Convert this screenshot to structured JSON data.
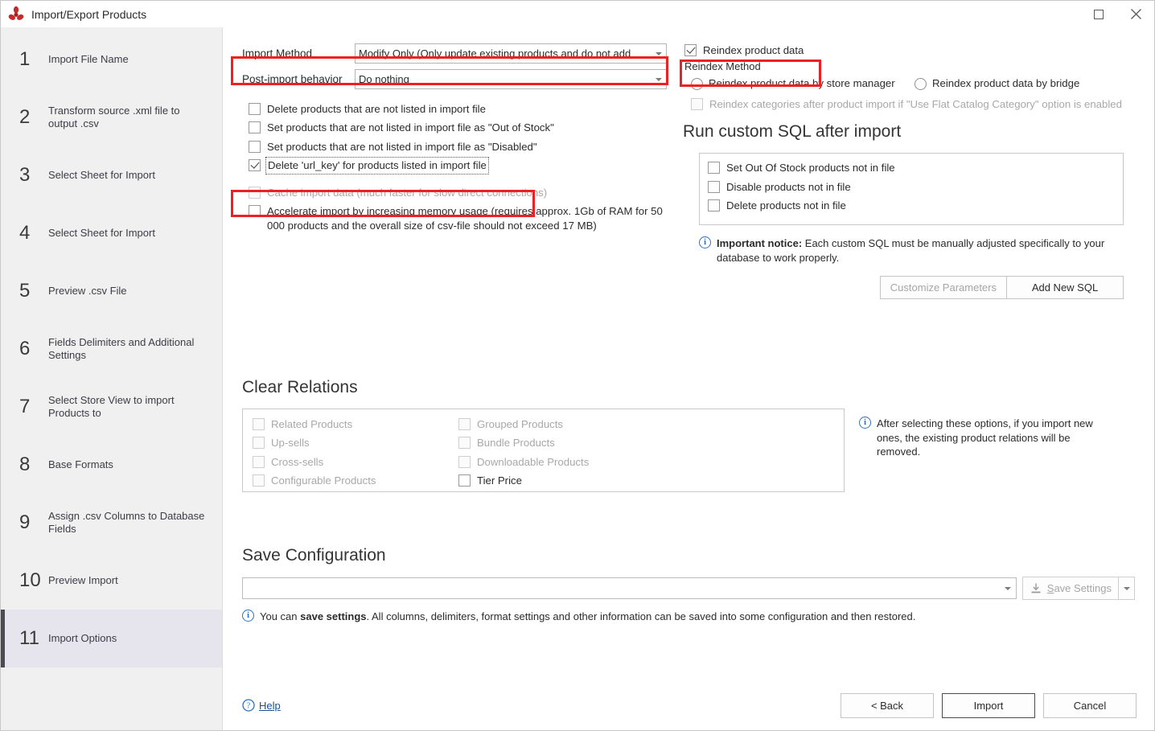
{
  "window": {
    "title": "Import/Export Products",
    "app_icon": "store-manager-logo-icon",
    "maximize_label": "",
    "close_label": "✕"
  },
  "sidebar": {
    "steps": [
      {
        "num": "1",
        "label": "Import File Name",
        "selected": false
      },
      {
        "num": "2",
        "label": "Transform source .xml file to output .csv",
        "selected": false
      },
      {
        "num": "3",
        "label": "Select Sheet for Import",
        "selected": false
      },
      {
        "num": "4",
        "label": "Select Sheet for Import",
        "selected": false
      },
      {
        "num": "5",
        "label": "Preview .csv File",
        "selected": false
      },
      {
        "num": "6",
        "label": "Fields Delimiters and Additional Settings",
        "selected": false
      },
      {
        "num": "7",
        "label": "Select Store View to import Products to",
        "selected": false
      },
      {
        "num": "8",
        "label": "Base Formats",
        "selected": false
      },
      {
        "num": "9",
        "label": "Assign .csv Columns to Database Fields",
        "selected": false
      },
      {
        "num": "10",
        "label": "Preview Import",
        "selected": false
      },
      {
        "num": "11",
        "label": "Import Options",
        "selected": true
      }
    ]
  },
  "import_method": {
    "label": "Import Method",
    "value": "Modify Only (Only update existing products and do not add",
    "highlighted": true
  },
  "post_import": {
    "label": "Post-import behavior",
    "value": "Do nothing"
  },
  "options": [
    {
      "label": "Delete products that are not listed in import file",
      "checked": false,
      "disabled": false,
      "focused": false
    },
    {
      "label": "Set products that are not listed in import file as \"Out of Stock\"",
      "checked": false,
      "disabled": false,
      "focused": false
    },
    {
      "label": "Set products that are not listed in import file as \"Disabled\"",
      "checked": false,
      "disabled": false,
      "focused": false
    },
    {
      "label": "Delete 'url_key' for products listed in import file",
      "checked": true,
      "disabled": false,
      "focused": true
    },
    {
      "label": "Cache import data (much faster for slow direct connections)",
      "checked": false,
      "disabled": true,
      "focused": false
    },
    {
      "label": "Accelerate import by increasing memory usage (requires approx. 1Gb of RAM for 50 000 products and the overall size of csv-file should not exceed 17 MB)",
      "checked": false,
      "disabled": false,
      "focused": false
    }
  ],
  "reindex": {
    "checkbox_label": "Reindex product data",
    "checked": true,
    "highlighted": true,
    "method_label": "Reindex Method",
    "radios": [
      {
        "label": "Reindex product data by store manager",
        "selected": false
      },
      {
        "label": "Reindex product data by bridge",
        "selected": false
      }
    ],
    "categories_option": {
      "label": "Reindex categories after product import if \"Use Flat Catalog Category\" option is enabled",
      "checked": false,
      "disabled": true
    }
  },
  "custom_sql": {
    "title": "Run custom SQL after import",
    "items": [
      {
        "label": "Set Out Of Stock products not in file",
        "checked": false
      },
      {
        "label": "Disable products not in file",
        "checked": false
      },
      {
        "label": "Delete products not in file",
        "checked": false
      }
    ],
    "notice_bold": "Important notice:",
    "notice_text": " Each custom SQL must be manually adjusted specifically to your database to work properly.",
    "customize_button": "Customize Parameters",
    "customize_disabled": true,
    "add_button": "Add New SQL"
  },
  "clear_relations": {
    "title": "Clear Relations",
    "column_left": [
      {
        "label": "Related Products",
        "checked": false,
        "disabled": true
      },
      {
        "label": "Up-sells",
        "checked": false,
        "disabled": true
      },
      {
        "label": "Cross-sells",
        "checked": false,
        "disabled": true
      },
      {
        "label": "Configurable Products",
        "checked": false,
        "disabled": true
      }
    ],
    "column_right": [
      {
        "label": "Grouped Products",
        "checked": false,
        "disabled": true
      },
      {
        "label": "Bundle Products",
        "checked": false,
        "disabled": true
      },
      {
        "label": "Downloadable Products",
        "checked": false,
        "disabled": true
      },
      {
        "label": "Tier Price",
        "checked": false,
        "disabled": false
      }
    ],
    "notice_text": "After selecting these options, if you import new ones, the existing product relations will be removed."
  },
  "save_configuration": {
    "title": "Save Configuration",
    "input_value": "",
    "input_placeholder": "",
    "save_button": "Save Settings",
    "save_button_disabled": true,
    "notice_prefix": "You can ",
    "notice_bold": "save settings",
    "notice_suffix": ". All columns, delimiters, format settings and other information can be saved into some configuration and then restored."
  },
  "footer": {
    "help_label": "Help",
    "help_icon": "question-circle-icon",
    "back_button": "< Back",
    "import_button": "Import",
    "cancel_button": "Cancel"
  },
  "colors": {
    "highlight": "#ed2024",
    "selection_bg": "#e6e4ec",
    "selection_bar": "#4c4a52",
    "sidebar_bg": "#f0f0f0",
    "link": "#1a4f9c",
    "info": "#2a72c8"
  }
}
